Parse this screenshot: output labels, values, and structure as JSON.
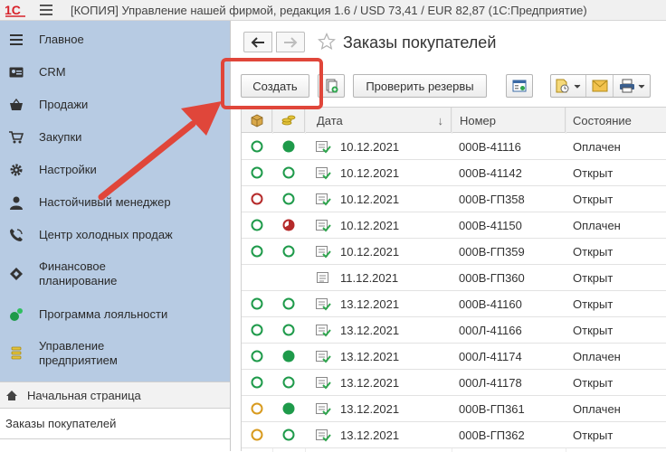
{
  "window": {
    "title": "[КОПИЯ] Управление нашей фирмой, редакция 1.6 / USD 73,41 / EUR 82,87  (1С:Предприятие)",
    "logo_text": "1С"
  },
  "sidebar": {
    "items": [
      {
        "label": "Главное",
        "icon": "hamburger-list-icon"
      },
      {
        "label": "CRM",
        "icon": "contact-card-icon"
      },
      {
        "label": "Продажи",
        "icon": "shopping-basket-icon"
      },
      {
        "label": "Закупки",
        "icon": "cart-icon"
      },
      {
        "label": "Настройки",
        "icon": "gear-icon"
      },
      {
        "label": "Настойчивый менеджер",
        "icon": "person-icon"
      },
      {
        "label": "Центр холодных продаж",
        "icon": "phone-icon"
      },
      {
        "label": "Финансовое планирование",
        "line1": "Финансовое",
        "line2": "планирование",
        "icon": "diamond-icon"
      },
      {
        "label": "Программа лояльности",
        "icon": "loyalty-dots-icon"
      },
      {
        "label": "Управление предприятием",
        "line1": "Управление",
        "line2": "предприятием",
        "icon": "coin-stack-icon"
      }
    ],
    "home": "Начальная страница",
    "open_window": "Заказы покупателей"
  },
  "page": {
    "title": "Заказы покупателей"
  },
  "toolbar": {
    "create": "Создать",
    "check_reserves": "Проверить резервы"
  },
  "table": {
    "columns": [
      "",
      "",
      "Дата",
      "Номер",
      "Состояние"
    ],
    "sort_indicator": "↓",
    "rows": [
      {
        "ship": "open-green",
        "pay": "full-green",
        "date": "10.12.2021",
        "number": "000В-41116",
        "status": "Оплачен"
      },
      {
        "ship": "open-green",
        "pay": "open-green",
        "date": "10.12.2021",
        "number": "000В-41142",
        "status": "Открыт"
      },
      {
        "ship": "open-red",
        "pay": "open-green",
        "date": "10.12.2021",
        "number": "000В-ГП358",
        "status": "Открыт"
      },
      {
        "ship": "open-green",
        "pay": "partial-red",
        "date": "10.12.2021",
        "number": "000В-41150",
        "status": "Оплачен"
      },
      {
        "ship": "open-green",
        "pay": "open-green",
        "date": "10.12.2021",
        "number": "000В-ГП359",
        "status": "Открыт"
      },
      {
        "ship": "none",
        "pay": "none",
        "date": "11.12.2021",
        "number": "000В-ГП360",
        "status": "Открыт"
      },
      {
        "ship": "open-green",
        "pay": "open-green",
        "date": "13.12.2021",
        "number": "000В-41160",
        "status": "Открыт"
      },
      {
        "ship": "open-green",
        "pay": "open-green",
        "date": "13.12.2021",
        "number": "000Л-41166",
        "status": "Открыт"
      },
      {
        "ship": "open-green",
        "pay": "full-green",
        "date": "13.12.2021",
        "number": "000Л-41174",
        "status": "Оплачен"
      },
      {
        "ship": "open-green",
        "pay": "open-green",
        "date": "13.12.2021",
        "number": "000Л-41178",
        "status": "Открыт"
      },
      {
        "ship": "open-orange",
        "pay": "full-green",
        "date": "13.12.2021",
        "number": "000В-ГП361",
        "status": "Оплачен"
      },
      {
        "ship": "open-orange",
        "pay": "open-green",
        "date": "13.12.2021",
        "number": "000В-ГП362",
        "status": "Открыт"
      }
    ]
  },
  "colors": {
    "sidebar_bg": "#b7cbe3",
    "accent_red": "#e0463a",
    "status_green": "#1e9a4a",
    "status_red": "#b52a2a",
    "status_orange": "#d89a1e"
  }
}
